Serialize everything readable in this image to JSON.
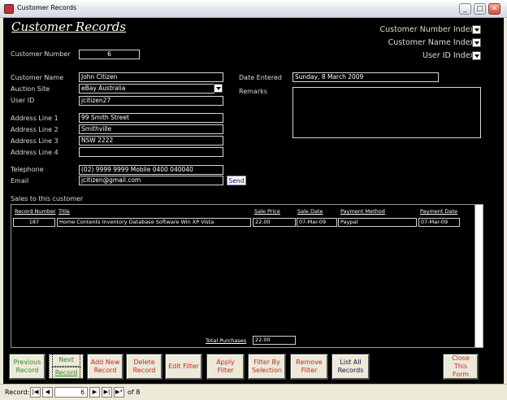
{
  "window": {
    "title": "Customer Records",
    "minimize": "_",
    "maximize": "□",
    "close": "✕"
  },
  "form": {
    "heading": "Customer Records",
    "index_selectors": [
      {
        "label": "Customer Number Index"
      },
      {
        "label": "Customer Name Index"
      },
      {
        "label": "User ID Index"
      }
    ],
    "customer_number": {
      "label": "Customer Number",
      "value": "6"
    },
    "customer_name": {
      "label": "Customer Name",
      "value": "John Citizen"
    },
    "auction_site": {
      "label": "Auction Site",
      "value": "eBay Australia"
    },
    "user_id": {
      "label": "User ID",
      "value": "jcitizen27"
    },
    "address1": {
      "label": "Address Line 1",
      "value": "99 Smith Street"
    },
    "address2": {
      "label": "Address Line 2",
      "value": "Smithville"
    },
    "address3": {
      "label": "Address Line 3",
      "value": "NSW  2222"
    },
    "address4": {
      "label": "Address Line 4",
      "value": ""
    },
    "telephone": {
      "label": "Telephone",
      "value": "(02) 9999 9999 Mobile 0400 040040"
    },
    "email": {
      "label": "Email",
      "value": "jcitizen@gmail.com",
      "send_label": "Send"
    },
    "date_entered": {
      "label": "Date Entered",
      "value": "Sunday, 8 March 2009"
    },
    "remarks": {
      "label": "Remarks",
      "value": ""
    }
  },
  "sales": {
    "title": "Sales to this customer",
    "columns": {
      "record_number": "Record Number",
      "title": "Title",
      "sale_price": "Sale Price",
      "sale_date": "Sale Date",
      "payment_method": "Payment Method",
      "payment_date": "Payment Date"
    },
    "rows": [
      {
        "record_number": "187",
        "title": "Home Contents Inventory Database Software Win XP Vista",
        "sale_price": "22.00",
        "sale_date": "07-Mar-09",
        "payment_method": "Paypal",
        "payment_date": "07-Mar-09"
      }
    ],
    "total_label": "Total Purchases",
    "total_value": "22.00"
  },
  "buttons": {
    "previous": [
      "Previous",
      "Record"
    ],
    "next": [
      "Next",
      "Record"
    ],
    "add": [
      "Add New",
      "Record"
    ],
    "delete": [
      "Delete",
      "Record"
    ],
    "edit_filter": [
      "Edit Filter"
    ],
    "apply_filter": [
      "Apply Filter"
    ],
    "filter_selection": [
      "Filter By",
      "Selection"
    ],
    "remove_filter": [
      "Remove",
      "Filter"
    ],
    "list_all": [
      "List All",
      "Records"
    ],
    "close_form": [
      "Close",
      "This Form"
    ]
  },
  "navigation": {
    "label": "Record:",
    "current": "6",
    "of_label": "of  8",
    "first": "|◀",
    "prev": "◀",
    "next": "▶",
    "last": "▶|",
    "new": "▶*"
  },
  "colors": {
    "background": "#000000",
    "green": "#2d8a2d",
    "red": "#c0282c",
    "face": "#ece9d8"
  }
}
